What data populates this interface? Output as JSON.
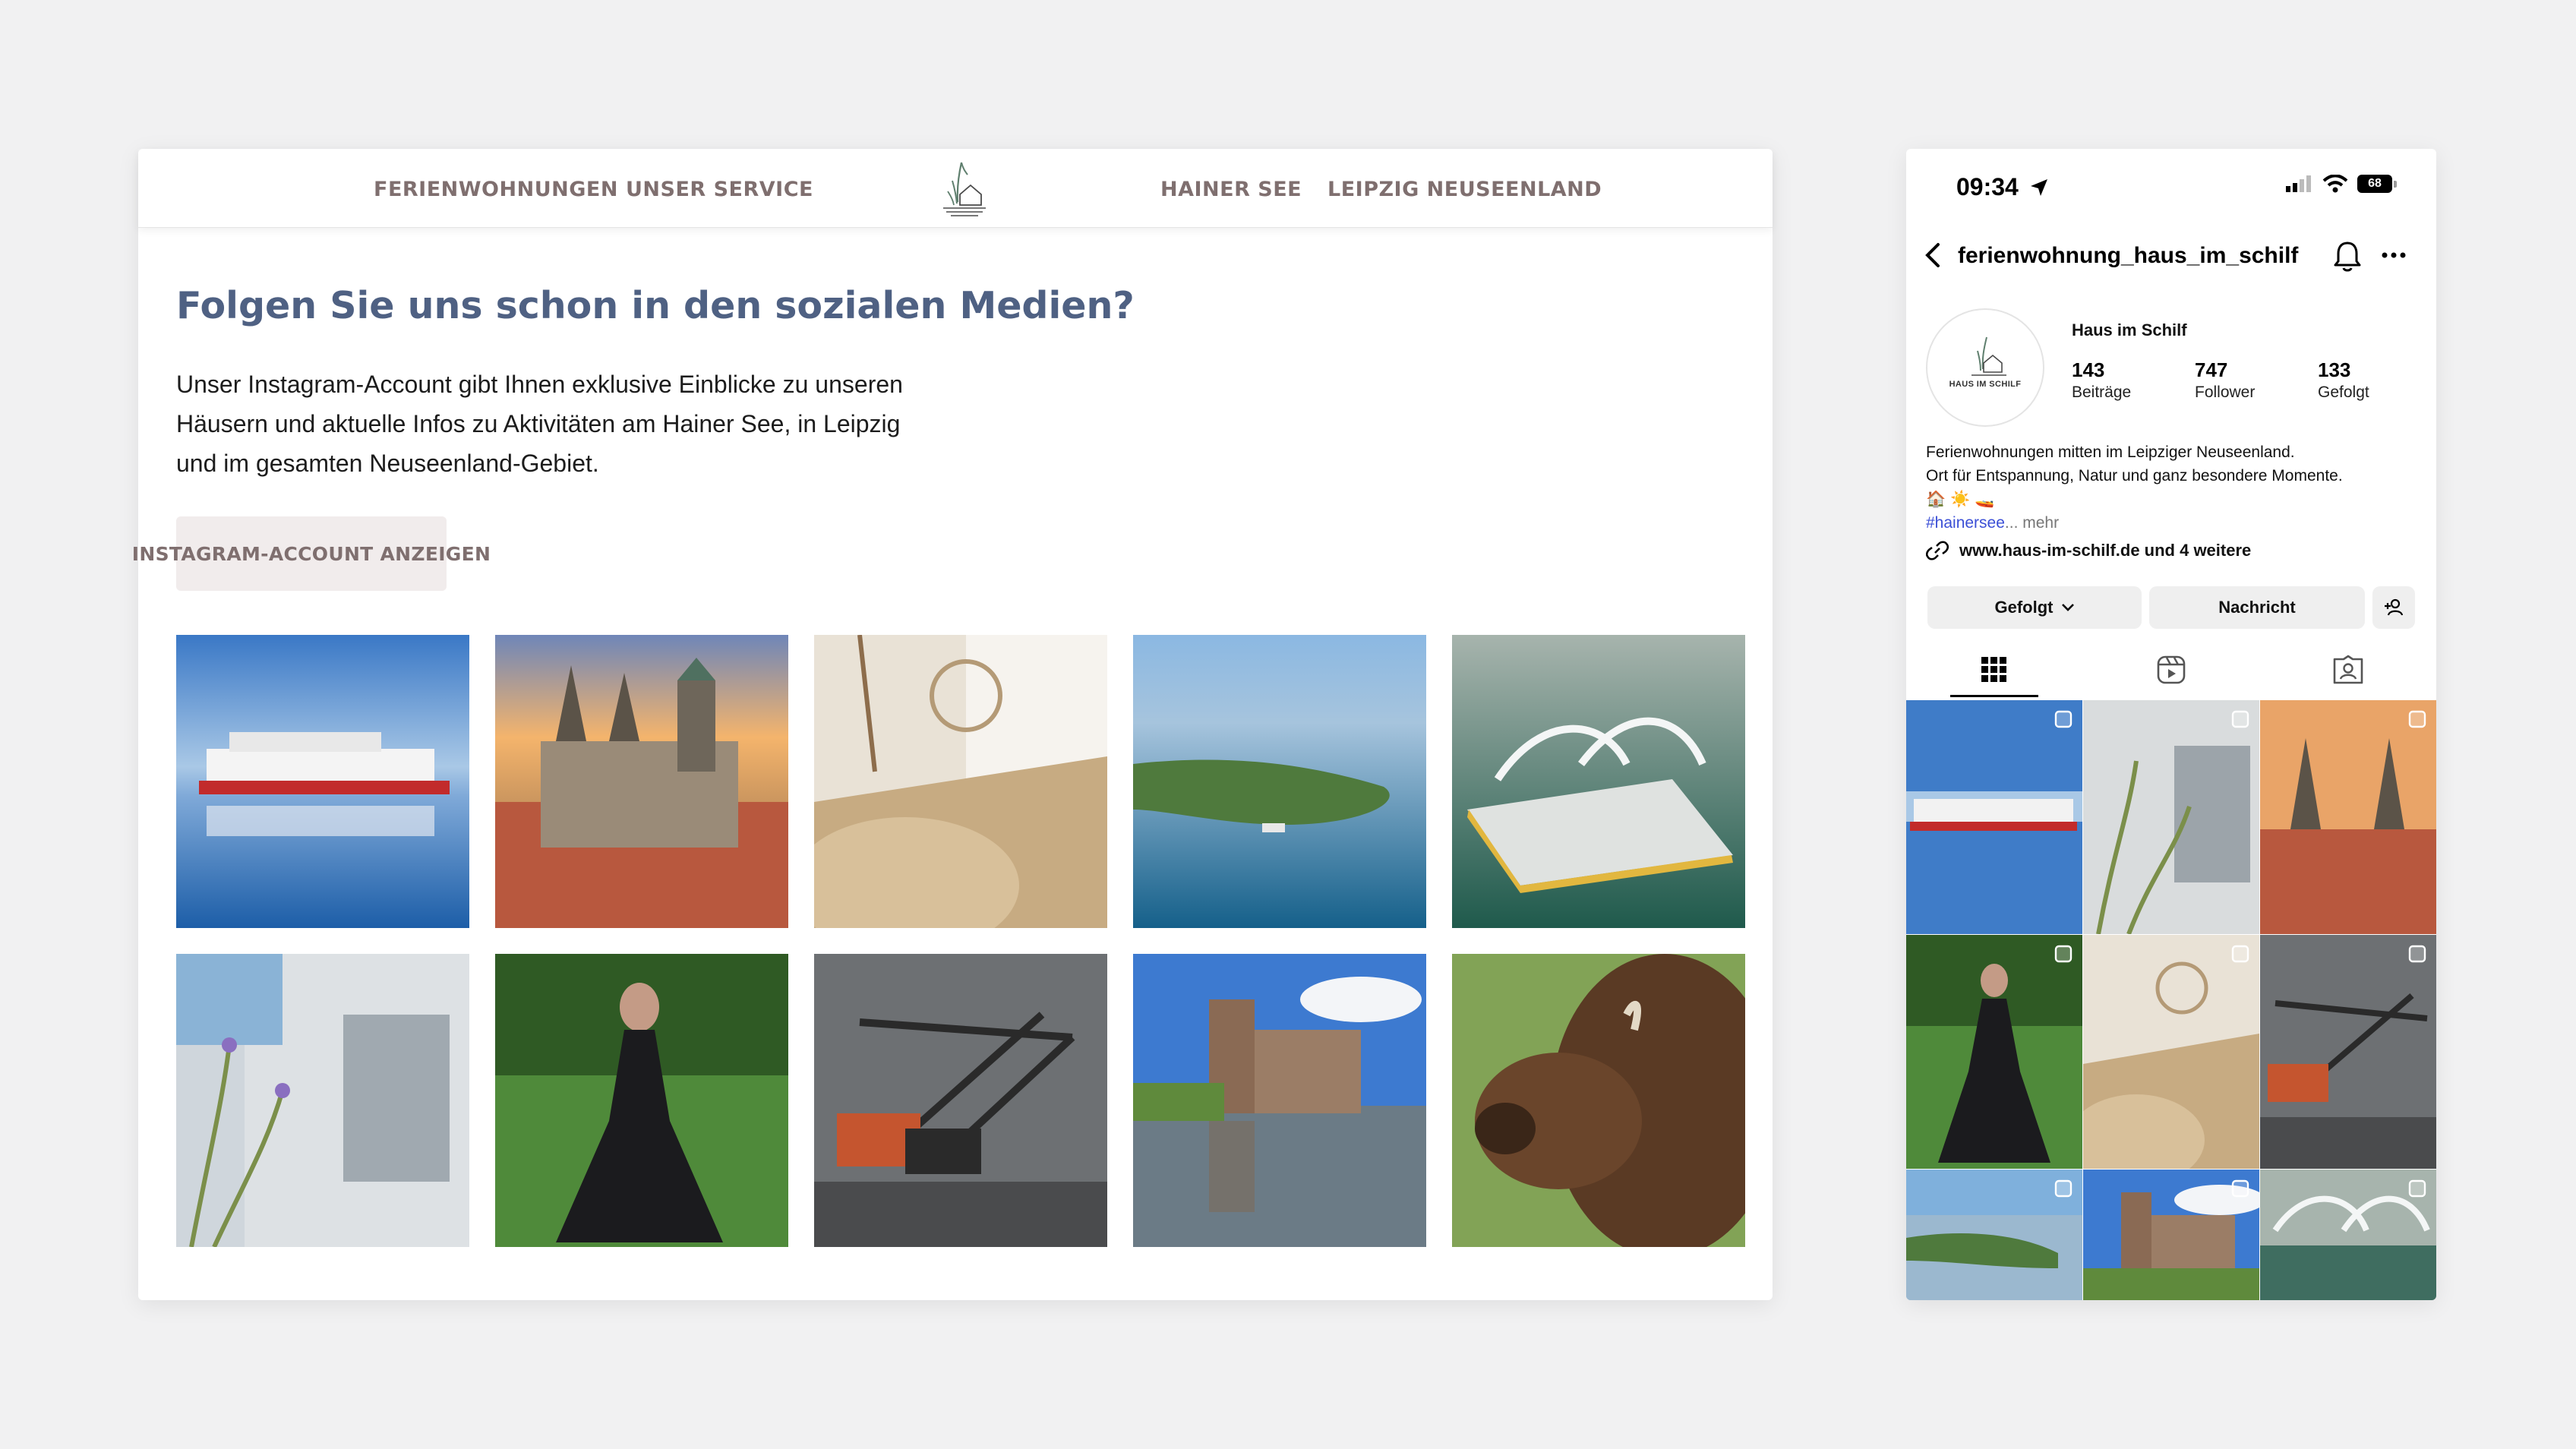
{
  "site": {
    "nav": {
      "item1": "FERIENWOHNUNGEN",
      "item2": "UNSER SERVICE",
      "item3": "HAINER SEE",
      "item4": "LEIPZIG NEUSEENLAND"
    },
    "title": "Folgen Sie uns schon in den sozialen Medien?",
    "text_lines": [
      "Unser Instagram-Account gibt Ihnen exklusive Einblicke zu unseren",
      "Häusern und aktuelle Infos zu Aktivitäten am Hainer See, in Leipzig",
      "und im gesamten Neuseenland-Gebiet."
    ],
    "button": "INSTAGRAM-ACCOUNT ANZEIGEN",
    "accent_color": "#4f6183",
    "nav_color": "#7f6f6f"
  },
  "phone": {
    "status": {
      "time": "09:34",
      "battery": "68"
    },
    "username": "ferienwohnung_haus_im_schilf",
    "avatar_text": "HAUS IM SCHILF",
    "display_name": "Haus im Schilf",
    "stats": [
      {
        "num": "143",
        "label": "Beiträge"
      },
      {
        "num": "747",
        "label": "Follower"
      },
      {
        "num": "133",
        "label": "Gefolgt"
      }
    ],
    "bio": {
      "line1": "Ferienwohnungen mitten im Leipziger Neuseenland.",
      "line2": "Ort für Entspannung, Natur und ganz besondere Momente.",
      "emoji": "🏠 ☀️ 🚤",
      "hashtag": "#hainersee",
      "more": "... mehr"
    },
    "link": "www.haus-im-schilf.de und 4 weitere",
    "buttons": {
      "follow": "Gefolgt",
      "message": "Nachricht"
    }
  }
}
